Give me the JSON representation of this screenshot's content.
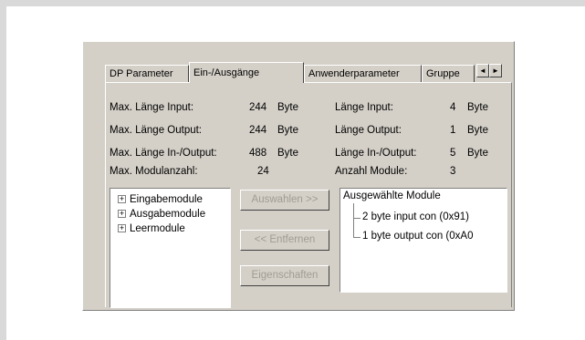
{
  "tabs": [
    {
      "label": "DP Parameter",
      "active": false
    },
    {
      "label": "Ein-/Ausgänge",
      "active": true
    },
    {
      "label": "Anwenderparameter",
      "active": false
    },
    {
      "label": "Gruppe",
      "active": false
    }
  ],
  "tab_scroll": {
    "left": "◄",
    "right": "►"
  },
  "info_left": [
    {
      "label": "Max. Länge Input:",
      "value": "244",
      "unit": "Byte"
    },
    {
      "label": "Max. Länge Output:",
      "value": "244",
      "unit": "Byte"
    },
    {
      "label": "Max. Länge In-/Output:",
      "value": "488",
      "unit": "Byte"
    },
    {
      "label": "Max. Modulanzahl:",
      "value": "24",
      "unit": ""
    }
  ],
  "info_right": [
    {
      "label": "Länge Input:",
      "value": "4",
      "unit": "Byte"
    },
    {
      "label": "Länge Output:",
      "value": "1",
      "unit": "Byte"
    },
    {
      "label": "Länge In-/Output:",
      "value": "5",
      "unit": "Byte"
    },
    {
      "label": "Anzahl Module:",
      "value": "3",
      "unit": ""
    }
  ],
  "module_tree": [
    {
      "label": "Eingabemodule",
      "expander": "+"
    },
    {
      "label": "Ausgabemodule",
      "expander": "+"
    },
    {
      "label": "Leermodule",
      "expander": "+"
    }
  ],
  "buttons": {
    "select": "Auswahlen >>",
    "remove": "<< Entfernen",
    "properties": "Eigenschaften"
  },
  "selected_modules": {
    "title": "Ausgewählte Module",
    "items": [
      "2 byte input con (0x91)",
      "1 byte output con (0xA0"
    ]
  }
}
